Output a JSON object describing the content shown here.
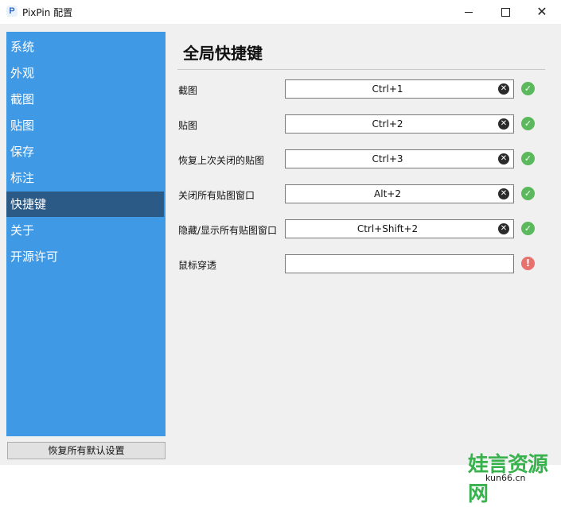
{
  "window": {
    "app_icon_letter": "P",
    "title": "PixPin 配置",
    "controls": {
      "minimize": "",
      "maximize": "",
      "close": "✕"
    }
  },
  "sidebar": {
    "items": [
      {
        "label": "系统"
      },
      {
        "label": "外观"
      },
      {
        "label": "截图"
      },
      {
        "label": "贴图"
      },
      {
        "label": "保存"
      },
      {
        "label": "标注"
      },
      {
        "label": "快捷键",
        "active": true
      },
      {
        "label": "关于"
      },
      {
        "label": "开源许可"
      }
    ],
    "reset_label": "恢复所有默认设置"
  },
  "content": {
    "title": "全局快捷键",
    "shortcuts": [
      {
        "label": "截图",
        "value": "Ctrl+1",
        "status": "ok"
      },
      {
        "label": "贴图",
        "value": "Ctrl+2",
        "status": "ok"
      },
      {
        "label": "恢复上次关闭的贴图",
        "value": "Ctrl+3",
        "status": "ok"
      },
      {
        "label": "关闭所有贴图窗口",
        "value": "Alt+2",
        "status": "ok"
      },
      {
        "label": "隐藏/显示所有贴图窗口",
        "value": "Ctrl+Shift+2",
        "status": "ok"
      },
      {
        "label": "鼠标穿透",
        "value": "",
        "status": "error"
      }
    ],
    "icons": {
      "clear": "✕",
      "ok": "✓",
      "error": "!"
    }
  },
  "watermark": {
    "text": "娃言资源网",
    "sub": "kun66.cn"
  }
}
